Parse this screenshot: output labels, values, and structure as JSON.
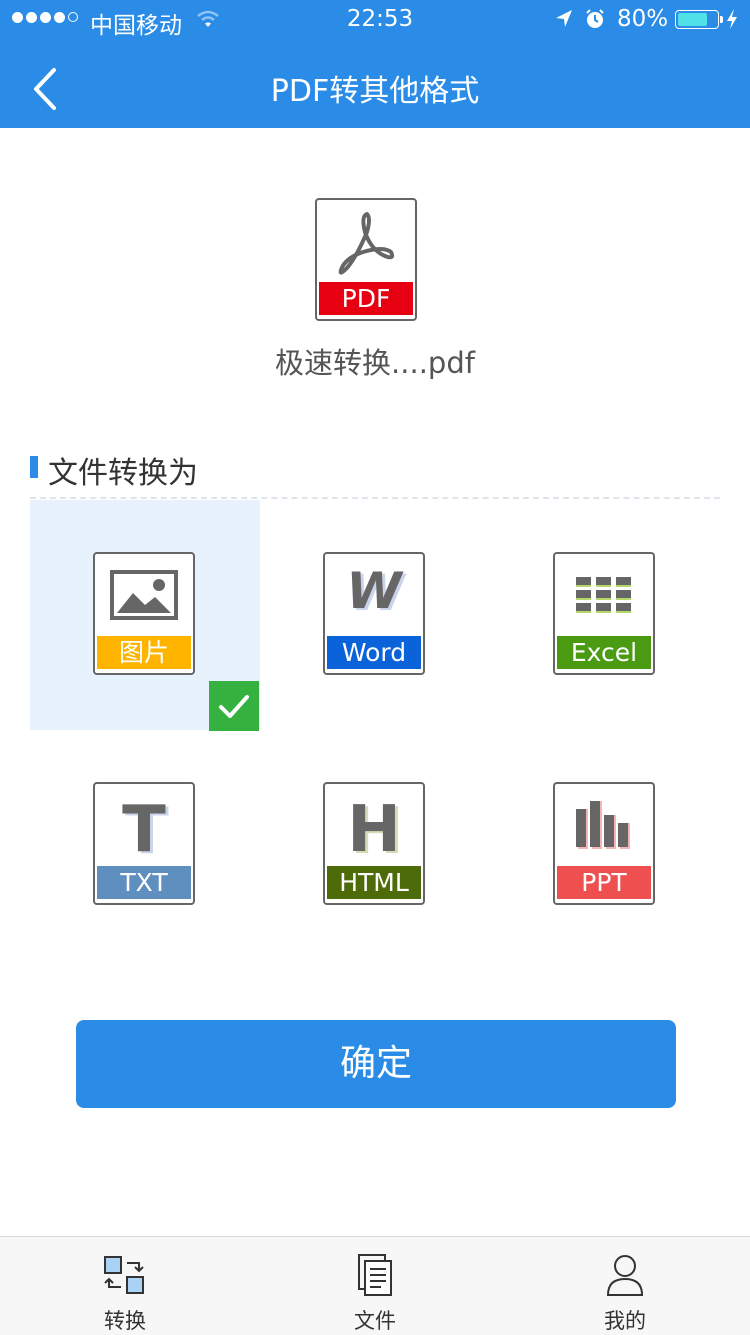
{
  "status_bar": {
    "carrier": "中国移动",
    "time": "22:53",
    "battery_percent": "80%",
    "battery_level": 0.8
  },
  "nav": {
    "title": "PDF转其他格式"
  },
  "source_file": {
    "type_label": "PDF",
    "type_color": "#e60012",
    "name": "极速转换....pdf"
  },
  "section": {
    "title": "文件转换为"
  },
  "formats": [
    {
      "label": "图片",
      "color": "#ffb400",
      "icon": "image-icon",
      "selected": true
    },
    {
      "label": "Word",
      "color": "#0a63d8",
      "icon": "word-icon",
      "selected": false
    },
    {
      "label": "Excel",
      "color": "#4a9a12",
      "icon": "excel-icon",
      "selected": false
    },
    {
      "label": "TXT",
      "color": "#5f8fbe",
      "icon": "txt-icon",
      "selected": false
    },
    {
      "label": "HTML",
      "color": "#4e6b0a",
      "icon": "html-icon",
      "selected": false
    },
    {
      "label": "PPT",
      "color": "#ee4f4f",
      "icon": "ppt-icon",
      "selected": false
    }
  ],
  "confirm_label": "确定",
  "tabs": [
    {
      "label": "转换",
      "icon": "convert-icon"
    },
    {
      "label": "文件",
      "icon": "file-icon"
    },
    {
      "label": "我的",
      "icon": "user-icon"
    }
  ],
  "colors": {
    "primary": "#2a8ce6",
    "selected_bg": "#e8f2fd",
    "check": "#34b13e"
  }
}
